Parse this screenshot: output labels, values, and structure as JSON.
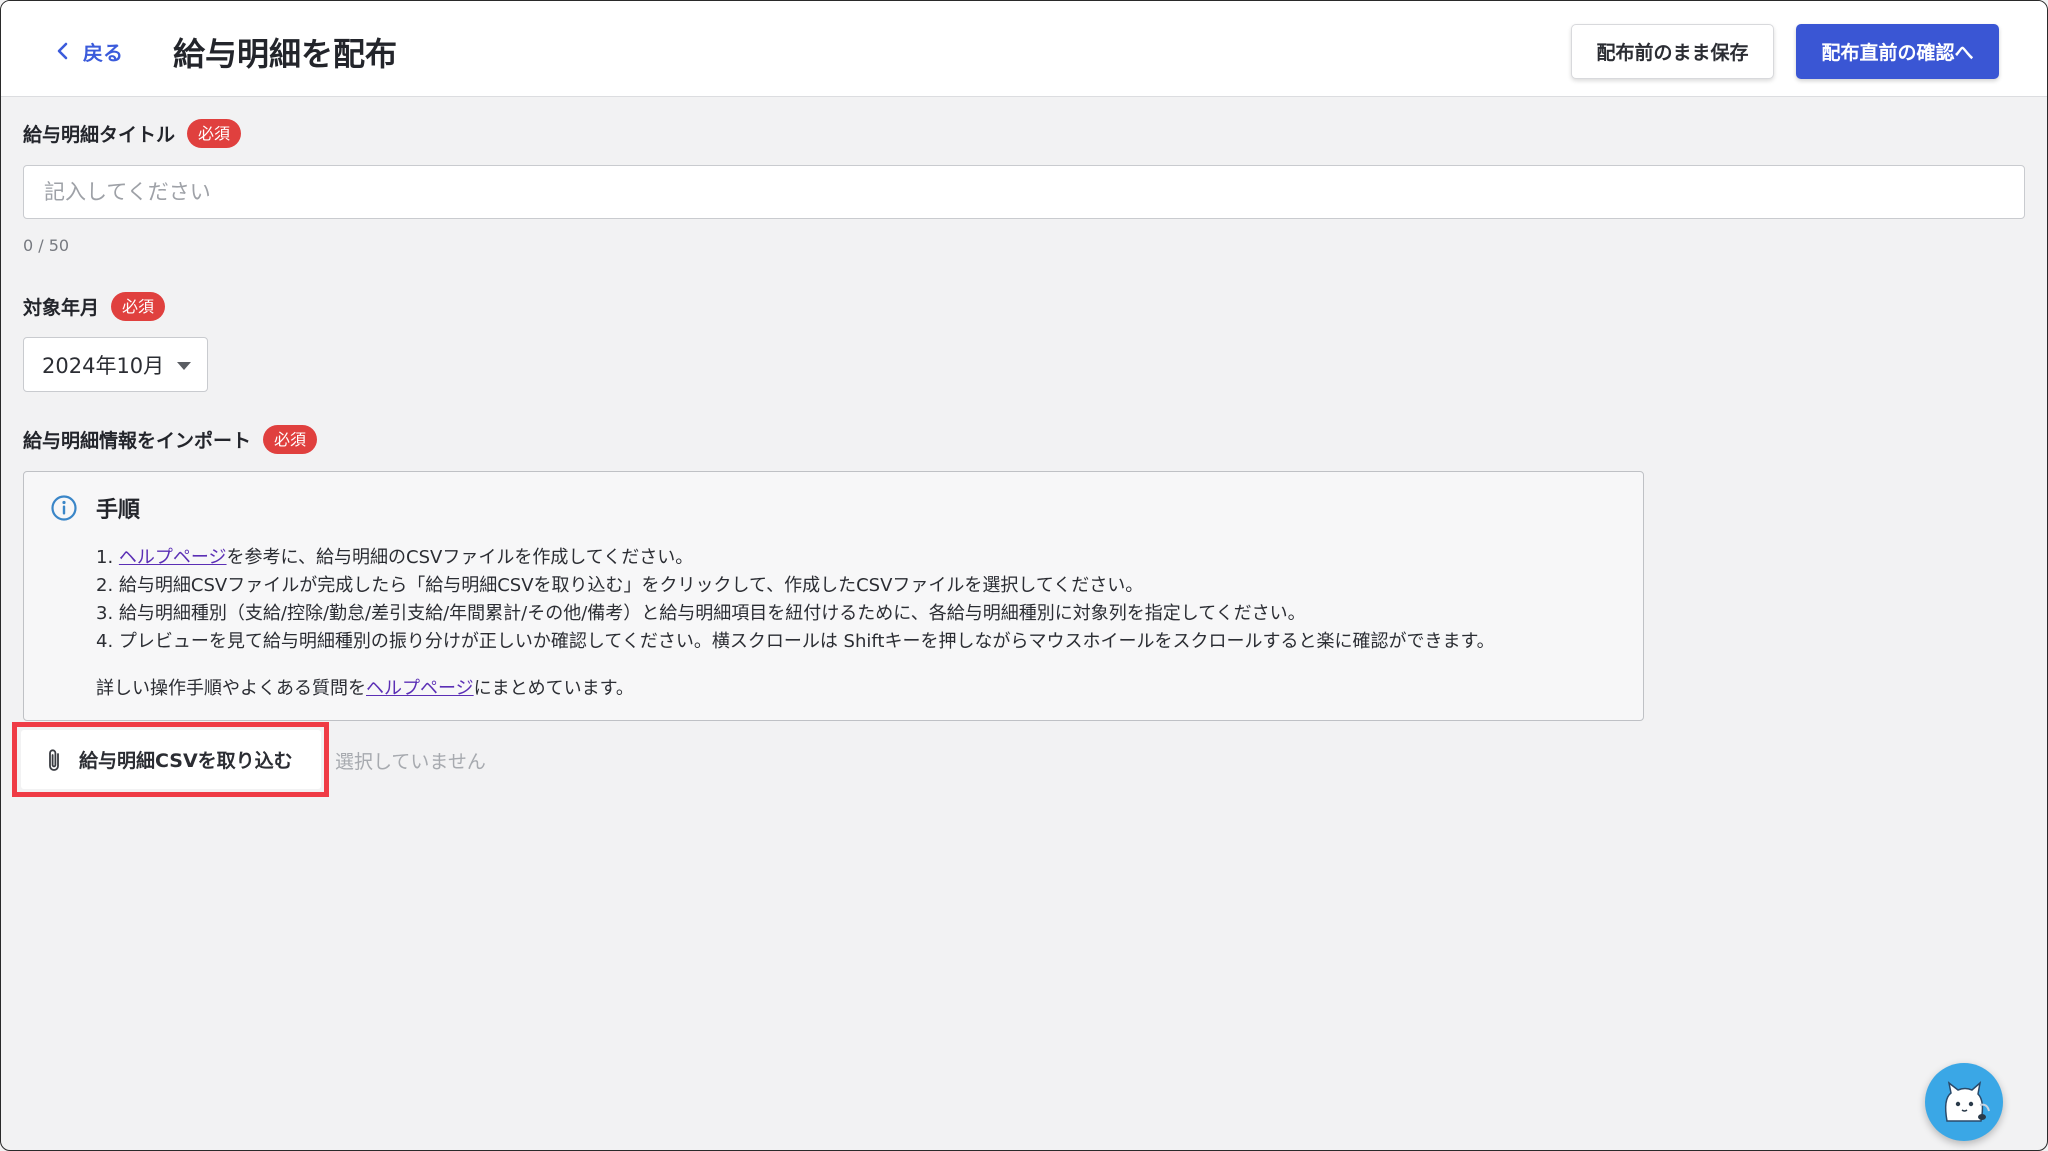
{
  "header": {
    "back_label": "戻る",
    "title": "給与明細を配布",
    "save_button": "配布前のまま保存",
    "confirm_button": "配布直前の確認へ"
  },
  "title_field": {
    "label": "給与明細タイトル",
    "badge": "必須",
    "placeholder": "記入してください",
    "value": "",
    "counter": "0 / 50"
  },
  "month_field": {
    "label": "対象年月",
    "badge": "必須",
    "selected": "2024年10月"
  },
  "import_section": {
    "label": "給与明細情報をインポート",
    "badge": "必須",
    "info_title": "手順",
    "steps": [
      {
        "num": "1. ",
        "link": "ヘルプページ",
        "text": "を参考に、給与明細のCSVファイルを作成してください。"
      },
      {
        "num": "2. ",
        "text": "給与明細CSVファイルが完成したら「給与明細CSVを取り込む」をクリックして、作成したCSVファイルを選択してください。"
      },
      {
        "num": "3. ",
        "text": "給与明細種別（支給/控除/勤怠/差引支給/年間累計/その他/備考）と給与明細項目を紐付けるために、各給与明細種別に対象列を指定してください。"
      },
      {
        "num": "4. ",
        "text": "プレビューを見て給与明細種別の振り分けが正しいか確認してください。横スクロールは Shiftキーを押しながらマウスホイールをスクロールすると楽に確認ができます。"
      }
    ],
    "footer_before": "詳しい操作手順やよくある質問を",
    "footer_link": "ヘルプページ",
    "footer_after": "にまとめています。",
    "import_button": "給与明細CSVを取り込む",
    "no_file_text": "選択していません"
  },
  "colors": {
    "accent": "#3a56d4",
    "required_badge": "#e0403e",
    "highlight": "#ef3b45",
    "link": "#5b2fb5"
  }
}
